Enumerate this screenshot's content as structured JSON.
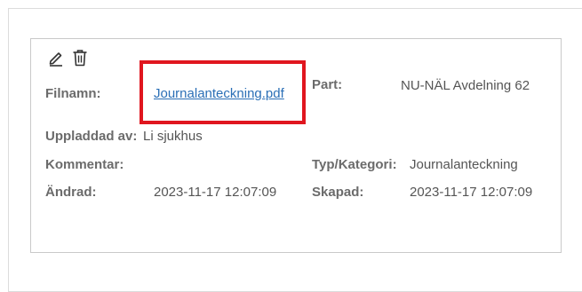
{
  "card": {
    "filename_label": "Filnamn:",
    "filename_value": "Journalanteckning.pdf",
    "part_label": "Part:",
    "part_value": "NU-NÄL Avdelning 62",
    "uploaded_by_label": "Uppladdad av:",
    "uploaded_by_value": "Li sjukhus",
    "comment_label": "Kommentar:",
    "comment_value": "",
    "type_label": "Typ/Kategori:",
    "type_value": "Journalanteckning",
    "changed_label": "Ändrad:",
    "changed_value": "2023-11-17 12:07:09",
    "created_label": "Skapad:",
    "created_value": "2023-11-17 12:07:09"
  },
  "icons": {
    "edit": "pencil-icon",
    "delete": "trash-icon"
  },
  "colors": {
    "link": "#2b6fb6",
    "highlight": "#e0161f",
    "label": "#6b6b6b",
    "value": "#555555"
  }
}
